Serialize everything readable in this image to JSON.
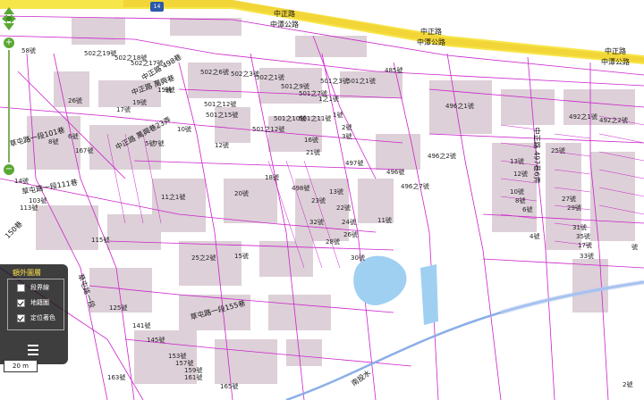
{
  "map": {
    "highway_shield": "14",
    "roads": [
      {
        "id": "r1",
        "text": "中正路"
      },
      {
        "id": "r2",
        "text": "中潭公路"
      },
      {
        "id": "r3",
        "text": "中正路"
      },
      {
        "id": "r4",
        "text": "中潭公路"
      },
      {
        "id": "r5",
        "text": "中正路"
      },
      {
        "id": "r6",
        "text": "中潭公路"
      },
      {
        "id": "r7",
        "text": "中正路 498巷"
      },
      {
        "id": "r8",
        "text": "中正路 萬興巷"
      },
      {
        "id": "r9",
        "text": "中正路 萬興巷23弄"
      },
      {
        "id": "r10",
        "text": "中正路 497巷6弄"
      },
      {
        "id": "r11",
        "text": "草屯路一段101巷"
      },
      {
        "id": "r12",
        "text": "草屯路一段111巷"
      },
      {
        "id": "r13",
        "text": "150巷"
      },
      {
        "id": "r14",
        "text": "草屯路一段"
      },
      {
        "id": "r15",
        "text": "草屯路一段155巷"
      },
      {
        "id": "r16",
        "text": "南投水"
      }
    ],
    "labels": [
      {
        "id": "a1",
        "text": "502之19號"
      },
      {
        "id": "a2",
        "text": "502之18號"
      },
      {
        "id": "a3",
        "text": "502之17號"
      },
      {
        "id": "a4",
        "text": "502之6號"
      },
      {
        "id": "a5",
        "text": "502之3號"
      },
      {
        "id": "a6",
        "text": "502之1號"
      },
      {
        "id": "a7",
        "text": "501之3號"
      },
      {
        "id": "a8",
        "text": "501之1號"
      },
      {
        "id": "a9",
        "text": "501之9號"
      },
      {
        "id": "a10",
        "text": "501之7號"
      },
      {
        "id": "a11",
        "text": "501之12號"
      },
      {
        "id": "a12",
        "text": "501之10號"
      },
      {
        "id": "a13",
        "text": "501之15號"
      },
      {
        "id": "a14",
        "text": "501之11號"
      },
      {
        "id": "a15",
        "text": "501之12號"
      },
      {
        "id": "a16",
        "text": "1之1號"
      },
      {
        "id": "a17",
        "text": "485號"
      },
      {
        "id": "a18",
        "text": "496之1號"
      },
      {
        "id": "a19",
        "text": "496之2號"
      },
      {
        "id": "a20",
        "text": "496之7號"
      },
      {
        "id": "a21",
        "text": "496號"
      },
      {
        "id": "a22",
        "text": "497號"
      },
      {
        "id": "a23",
        "text": "498號"
      },
      {
        "id": "a24",
        "text": "492之1號"
      },
      {
        "id": "a25",
        "text": "492之2號"
      },
      {
        "id": "a26",
        "text": "58號"
      },
      {
        "id": "a27",
        "text": "26號"
      },
      {
        "id": "a28",
        "text": "15號"
      },
      {
        "id": "a29",
        "text": "17號"
      },
      {
        "id": "a30",
        "text": "19號"
      },
      {
        "id": "a31",
        "text": "8號"
      },
      {
        "id": "a32",
        "text": "6號"
      },
      {
        "id": "a33",
        "text": "10號"
      },
      {
        "id": "a34",
        "text": "12號"
      },
      {
        "id": "a35",
        "text": "5號"
      },
      {
        "id": "a36",
        "text": "7號"
      },
      {
        "id": "a37",
        "text": "9號"
      },
      {
        "id": "a38",
        "text": "2號"
      },
      {
        "id": "a39",
        "text": "3號"
      },
      {
        "id": "a40",
        "text": "1號"
      },
      {
        "id": "a41",
        "text": "11號"
      },
      {
        "id": "a42",
        "text": "13號"
      },
      {
        "id": "a43",
        "text": "18號"
      },
      {
        "id": "a44",
        "text": "20號"
      },
      {
        "id": "a45",
        "text": "22號"
      },
      {
        "id": "a46",
        "text": "24號"
      },
      {
        "id": "a47",
        "text": "26號"
      },
      {
        "id": "a48",
        "text": "28號"
      },
      {
        "id": "a49",
        "text": "30號"
      },
      {
        "id": "a50",
        "text": "32號"
      },
      {
        "id": "a51",
        "text": "23號"
      },
      {
        "id": "a52",
        "text": "21號"
      },
      {
        "id": "a53",
        "text": "16號"
      },
      {
        "id": "a54",
        "text": "14號"
      },
      {
        "id": "a55",
        "text": "103號"
      },
      {
        "id": "a56",
        "text": "113號"
      },
      {
        "id": "a57",
        "text": "115號"
      },
      {
        "id": "a58",
        "text": "125號"
      },
      {
        "id": "a59",
        "text": "141號"
      },
      {
        "id": "a60",
        "text": "145號"
      },
      {
        "id": "a61",
        "text": "153號"
      },
      {
        "id": "a62",
        "text": "157號"
      },
      {
        "id": "a63",
        "text": "159號"
      },
      {
        "id": "a64",
        "text": "161號"
      },
      {
        "id": "a65",
        "text": "163號"
      },
      {
        "id": "a66",
        "text": "165號"
      },
      {
        "id": "a67",
        "text": "167號"
      },
      {
        "id": "a68",
        "text": "25之2號"
      },
      {
        "id": "a69",
        "text": "11之1號"
      },
      {
        "id": "a70",
        "text": "15號"
      },
      {
        "id": "a71",
        "text": "17號"
      },
      {
        "id": "a72",
        "text": "33號"
      },
      {
        "id": "a73",
        "text": "35號"
      },
      {
        "id": "a74",
        "text": "31號"
      },
      {
        "id": "a75",
        "text": "29號"
      },
      {
        "id": "a76",
        "text": "27號"
      },
      {
        "id": "a77",
        "text": "25號"
      },
      {
        "id": "a78",
        "text": "13號"
      },
      {
        "id": "a79",
        "text": "12號"
      },
      {
        "id": "a80",
        "text": "10號"
      },
      {
        "id": "a81",
        "text": "8號"
      },
      {
        "id": "a82",
        "text": "6號"
      },
      {
        "id": "a83",
        "text": "4號"
      },
      {
        "id": "a84",
        "text": "2號"
      },
      {
        "id": "a85",
        "text": "號"
      }
    ]
  },
  "nav": {
    "zoom_in": "+",
    "zoom_out": "−"
  },
  "layers": {
    "title": "額外圖層",
    "items": [
      {
        "label": "段界線",
        "checked": false
      },
      {
        "label": "地籍圖",
        "checked": true
      },
      {
        "label": "定位著色",
        "checked": true
      }
    ]
  },
  "scale": "20 m",
  "colors": {
    "highway": "#f7e64a",
    "parcel_line": "#cc22cc",
    "building": "#ddd0d8",
    "water": "#9fd0f2",
    "river_line": "#8aaee8",
    "nav_green": "#5aa833",
    "panel_title": "#ffe34a"
  }
}
